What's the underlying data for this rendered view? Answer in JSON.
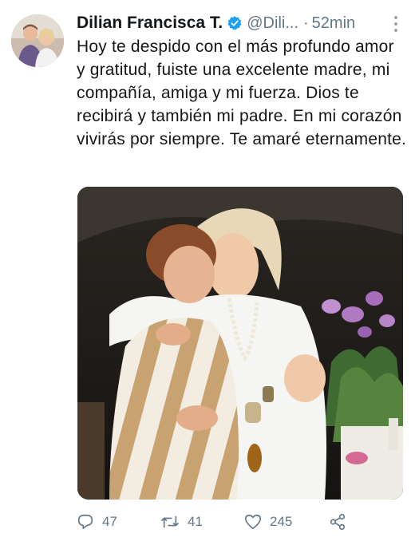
{
  "tweet": {
    "author_name": "Dilian Francisca T.",
    "handle": "@Dili...",
    "separator": "·",
    "time": "52min",
    "text": "Hoy te despido con el más profundo amor y gratitud, fuiste una excelente madre, mi compañía, amiga y mi fuerza. Dios te recibirá y también mi padre. En mi corazón vivirás por siempre. Te amaré eternamente."
  },
  "actions": {
    "replies": "47",
    "retweets": "41",
    "likes": "245"
  },
  "colors": {
    "verified": "#1da1f2",
    "muted": "#657786",
    "text": "#14171a"
  },
  "icons": [
    "verified-badge-icon",
    "more-options-icon",
    "reply-icon",
    "retweet-icon",
    "like-icon",
    "share-icon"
  ]
}
